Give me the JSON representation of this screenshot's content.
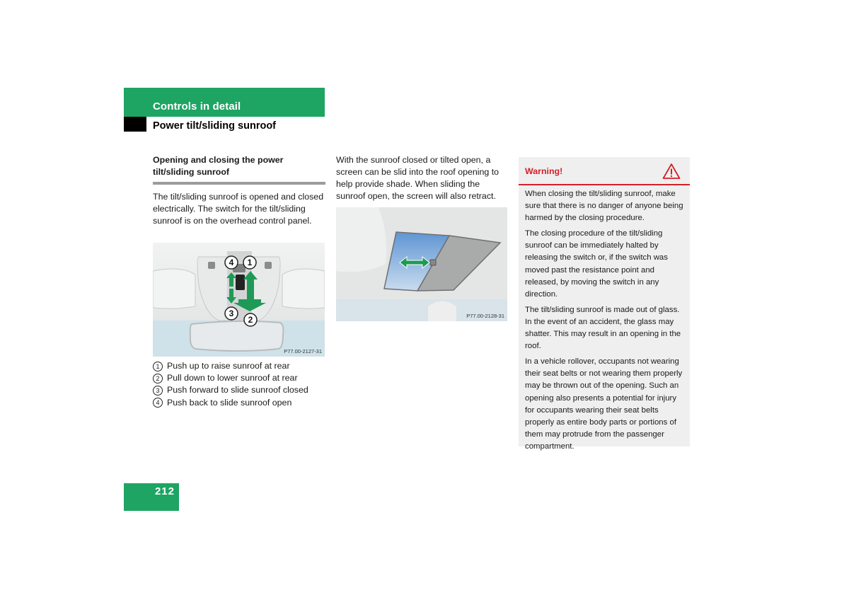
{
  "header": {
    "section": "Controls in detail",
    "subsection": "Power tilt/sliding sunroof"
  },
  "left_column": {
    "heading": "Opening and closing the power tilt/sliding sunroof",
    "paragraph": "The tilt/sliding sunroof is opened and closed electrically. The switch for the tilt/sliding sunroof is on the overhead control panel.",
    "figure": {
      "code": "P77.00-2127-31",
      "callouts": [
        "4",
        "1",
        "3",
        "2"
      ]
    },
    "legend": [
      {
        "num": "1",
        "text": "Push up to raise sunroof at rear"
      },
      {
        "num": "2",
        "text": "Pull down to lower sunroof at rear"
      },
      {
        "num": "3",
        "text": "Push forward to slide sunroof closed"
      },
      {
        "num": "4",
        "text": "Push back to slide sunroof open"
      }
    ]
  },
  "middle_column": {
    "paragraph": "With the sunroof closed or tilted open, a screen can be slid into the roof opening to help provide shade. When sliding the sunroof open, the screen will also retract.",
    "figure": {
      "code": "P77.00-2128-31"
    }
  },
  "warning": {
    "title": "Warning!",
    "icon": "warning-triangle-icon",
    "paragraphs": [
      "When closing the tilt/sliding sunroof, make sure that there is no danger of anyone being harmed by the closing procedure.",
      "The closing procedure of the tilt/sliding sunroof can be immediately halted by releasing the switch or, if the switch was moved past the resistance point and released, by moving the switch in any direction.",
      "The tilt/sliding sunroof is made out of glass. In the event of an accident, the glass may shatter. This may result in an opening in the roof.",
      "In a vehicle rollover, occupants not wearing their seat belts or not wearing them properly may be thrown out of the opening. Such an opening also presents a potential for injury for occupants wearing their seat belts properly as entire body parts or portions of them may protrude from the passenger compartment."
    ]
  },
  "footer": {
    "page_number": "212"
  },
  "colors": {
    "brand_green": "#1ea463",
    "warning_red": "#d4202a",
    "warning_bg": "#efefef"
  }
}
